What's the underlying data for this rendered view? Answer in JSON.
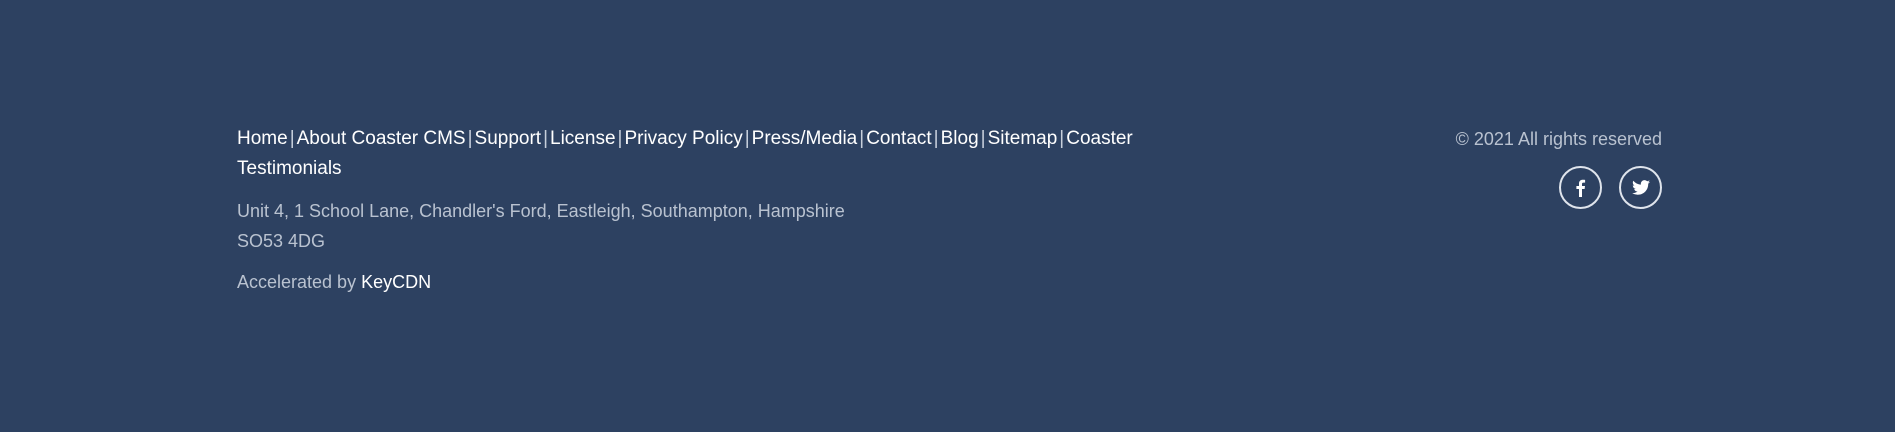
{
  "footer": {
    "nav": [
      {
        "label": "Home"
      },
      {
        "label": "About Coaster CMS"
      },
      {
        "label": "Support"
      },
      {
        "label": "License"
      },
      {
        "label": "Privacy Policy"
      },
      {
        "label": "Press/Media"
      },
      {
        "label": "Contact"
      },
      {
        "label": "Blog"
      },
      {
        "label": "Sitemap"
      },
      {
        "label": "Coaster Testimonials"
      }
    ],
    "separator": "|",
    "address": {
      "line1": "Unit 4, 1 School Lane, Chandler's Ford, Eastleigh, Southampton, Hampshire",
      "line2": "SO53 4DG"
    },
    "accelerated": {
      "prefix": "Accelerated by ",
      "link": "KeyCDN"
    },
    "copyright": "© 2021 All rights reserved",
    "social": [
      {
        "icon": "facebook-icon"
      },
      {
        "icon": "twitter-icon"
      }
    ]
  },
  "colors": {
    "background": "#2d4161",
    "link": "#ffffff",
    "muted_text": "#b9c2d0"
  }
}
